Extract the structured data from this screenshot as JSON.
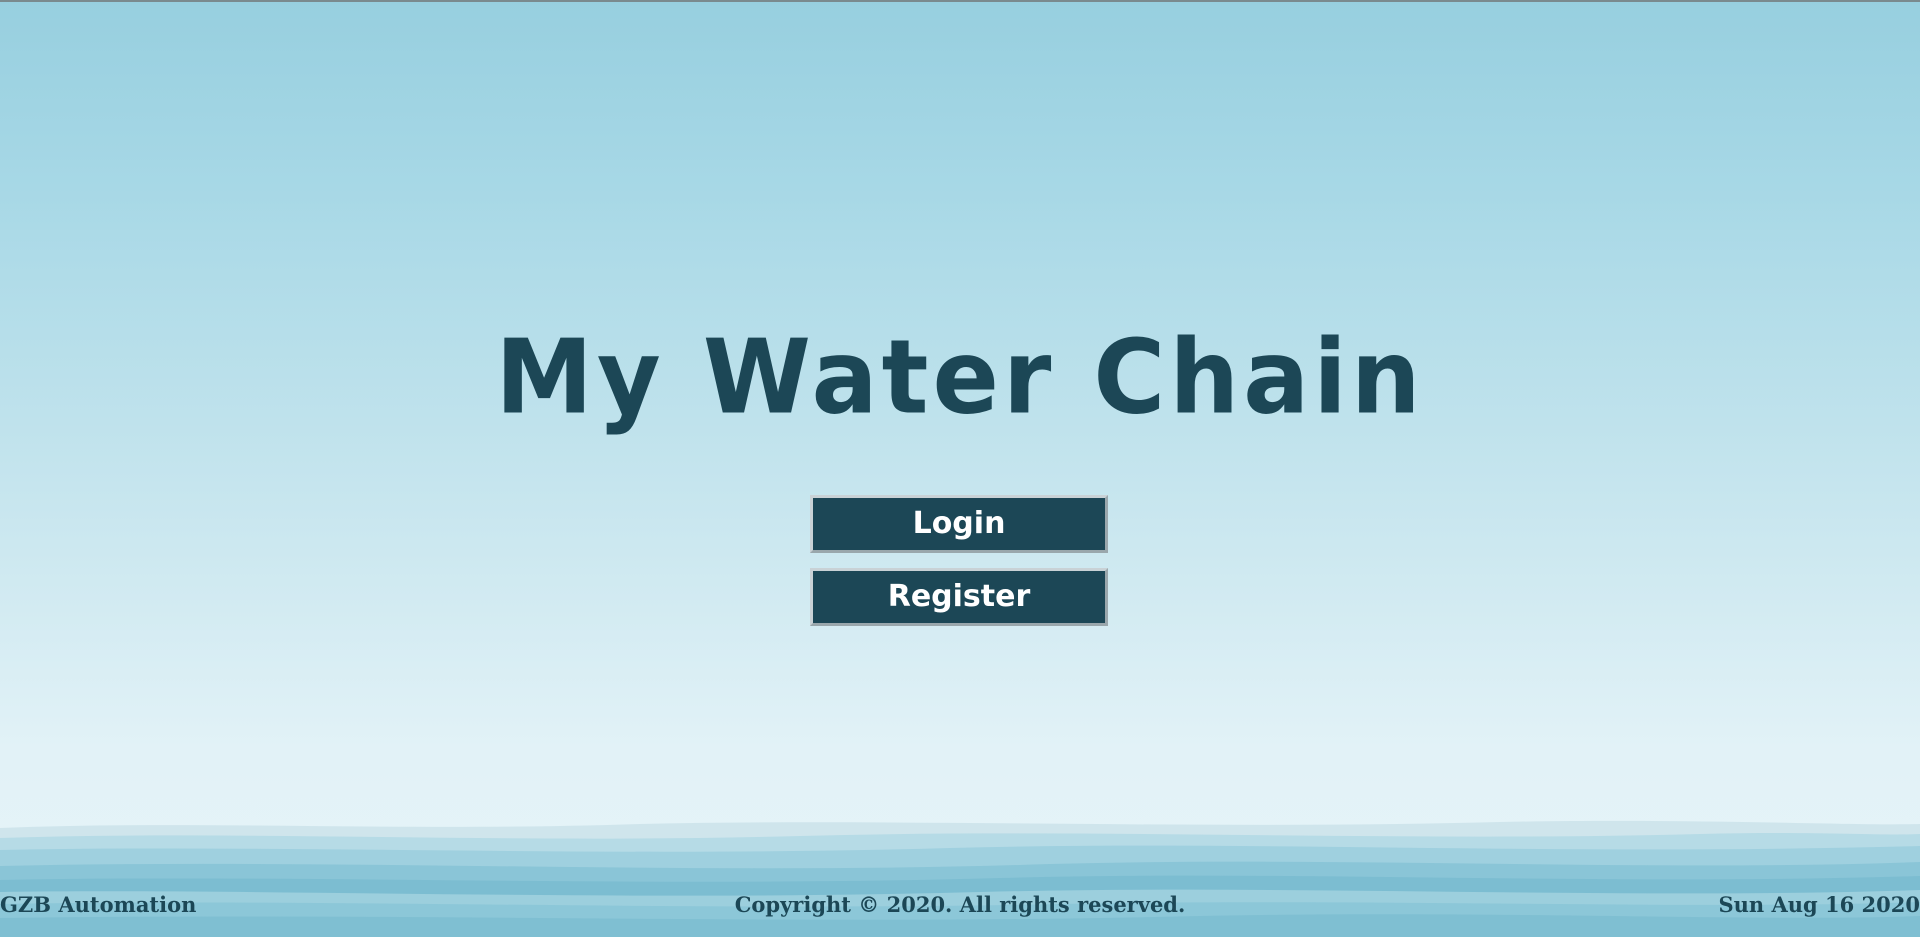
{
  "app": {
    "title": "My Water Chain"
  },
  "actions": {
    "login_label": "Login",
    "register_label": "Register"
  },
  "footer": {
    "company": "GZB Automation",
    "copyright": "Copyright © 2020. All rights reserved.",
    "date": "Sun Aug 16 2020"
  },
  "colors": {
    "primary": "#1c4756",
    "background_top": "#97cfdf",
    "background_bottom": "#e6f4f8",
    "button_text": "#ffffff"
  }
}
